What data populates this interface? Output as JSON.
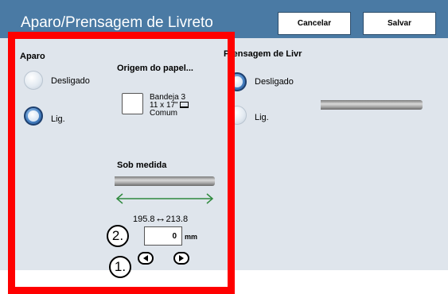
{
  "header": {
    "title": "Aparo/Prensagem de Livreto",
    "cancel_label": "Cancelar",
    "save_label": "Salvar"
  },
  "trim": {
    "heading": "Aparo",
    "option_off": "Desligado",
    "option_on": "Lig.",
    "selected": "Lig."
  },
  "paper_source": {
    "heading": "Origem do papel...",
    "tray_line1": "Bandeja 3",
    "tray_line2": "11 x 17\"",
    "tray_line3": "Comum"
  },
  "custom": {
    "heading": "Sob medida",
    "range_min": "195.8",
    "range_symbol": "↔",
    "range_max": "213.8",
    "value": "0",
    "unit": "mm"
  },
  "press": {
    "heading": "Prensagem de Livr",
    "option_off": "Desligado",
    "option_on": "Lig.",
    "selected": "Desligado"
  },
  "annotations": {
    "step1": "1.",
    "step2": "2."
  },
  "colors": {
    "header_bg": "#4a7aa4",
    "panel_bg": "#dfe5ec",
    "highlight_border": "#ff0000",
    "arrow_green": "#2f8a3e"
  }
}
